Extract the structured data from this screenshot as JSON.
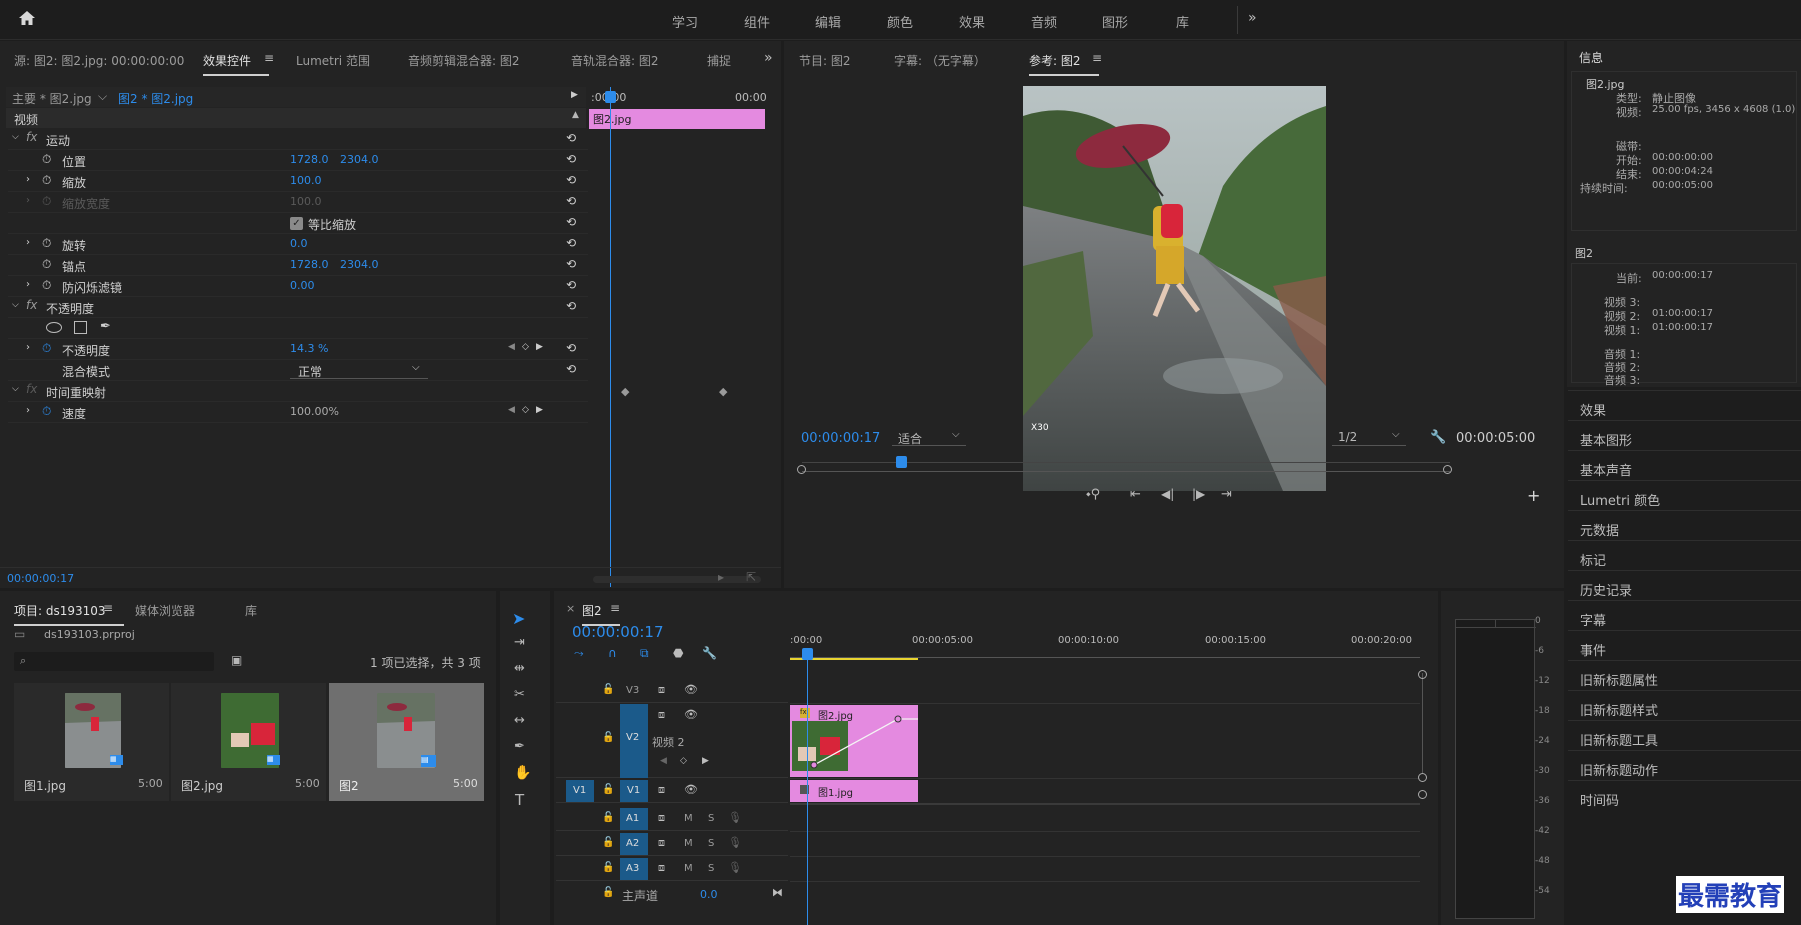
{
  "menu": {
    "workspaces": [
      "学习",
      "组件",
      "编辑",
      "颜色",
      "效果",
      "音频",
      "图形",
      "库"
    ]
  },
  "effect_panel": {
    "tabs": [
      "源: 图2: 图2.jpg: 00:00:00:00",
      "效果控件",
      "Lumetri 范围",
      "音频剪辑混合器: 图2",
      "音轨混合器: 图2",
      "捕捉"
    ],
    "master_label": "主要 * 图2.jpg",
    "clip_label": "图2 * 图2.jpg",
    "section_video": "视频",
    "motion": "运动",
    "position": "位置",
    "position_x": "1728.0",
    "position_y": "2304.0",
    "scale": "缩放",
    "scale_val": "100.0",
    "scale_w": "缩放宽度",
    "scale_w_val": "100.0",
    "uniform": "等比缩放",
    "rotation": "旋转",
    "rotation_val": "0.0",
    "anchor": "锚点",
    "anchor_x": "1728.0",
    "anchor_y": "2304.0",
    "antiflicker": "防闪烁滤镜",
    "antiflicker_val": "0.00",
    "opacity_section": "不透明度",
    "opacity": "不透明度",
    "opacity_val": "14.3 %",
    "blend": "混合模式",
    "blend_val": "正常",
    "timeremap": "时间重映射",
    "speed": "速度",
    "speed_val": "100.00%",
    "timecode": "00:00:00:17",
    "mini_start": ":00:00",
    "mini_end": "00:00",
    "mini_clip": "图2.jpg"
  },
  "program": {
    "tabs": [
      "节目: 图2",
      "字幕: （无字幕）",
      "参考: 图2"
    ],
    "timecode": "00:00:00:17",
    "fit": "适合",
    "res": "1/2",
    "duration": "00:00:05:00",
    "watermark": "X30"
  },
  "info": {
    "title": "信息",
    "clip": "图2.jpg",
    "type_label": "类型:",
    "type_val": "静止图像",
    "video_label": "视频:",
    "video_val": "25.00 fps, 3456 x 4608 (1.0)",
    "tape_label": "磁带:",
    "start_label": "开始:",
    "start_val": "00:00:00:00",
    "end_label": "结束:",
    "end_val": "00:00:04:24",
    "dur_label": "持续时间:",
    "dur_val": "00:00:05:00",
    "seq": "图2",
    "cur_label": "当前:",
    "cur_val": "00:00:00:17",
    "v3": "视频 3:",
    "v2": "视频 2:",
    "v2_val": "01:00:00:17",
    "v1": "视频 1:",
    "v1_val": "01:00:00:17",
    "a1": "音频 1:",
    "a2": "音频 2:",
    "a3": "音频 3:"
  },
  "right_panels": [
    "效果",
    "基本图形",
    "基本声音",
    "Lumetri 颜色",
    "元数据",
    "标记",
    "历史记录",
    "字幕",
    "事件",
    "旧新标题属性",
    "旧新标题样式",
    "旧新标题工具",
    "旧新标题动作",
    "时间码"
  ],
  "project": {
    "tabs": [
      "项目: ds193103",
      "媒体浏览器",
      "库"
    ],
    "file": "ds193103.prproj",
    "selection": "1 项已选择，共 3 项",
    "items": [
      {
        "name": "图1.jpg",
        "dur": "5:00"
      },
      {
        "name": "图2.jpg",
        "dur": "5:00"
      },
      {
        "name": "图2",
        "dur": "5:00"
      }
    ]
  },
  "timeline": {
    "tab": "图2",
    "timecode": "00:00:00:17",
    "ruler": [
      ":00:00",
      "00:00:05:00",
      "00:00:10:00",
      "00:00:15:00",
      "00:00:20:00"
    ],
    "tracks": {
      "v3": "V3",
      "v2": "V2",
      "v2name": "视频 2",
      "v1": "V1",
      "a1": "A1",
      "a2": "A2",
      "a3": "A3",
      "master": "主声道",
      "master_val": "0.0",
      "m": "M",
      "s": "S"
    },
    "clip_v2": "图2.jpg",
    "clip_v1": "图1.jpg"
  },
  "meter_ticks": [
    "0",
    "-6",
    "-12",
    "-18",
    "-24",
    "-30",
    "-36",
    "-42",
    "-48",
    "-54"
  ],
  "brand": "最需教育",
  "colors": {
    "accent": "#2d8ceb",
    "clip_pink": "#e48ae0",
    "track_blue": "#1b5a8a"
  }
}
